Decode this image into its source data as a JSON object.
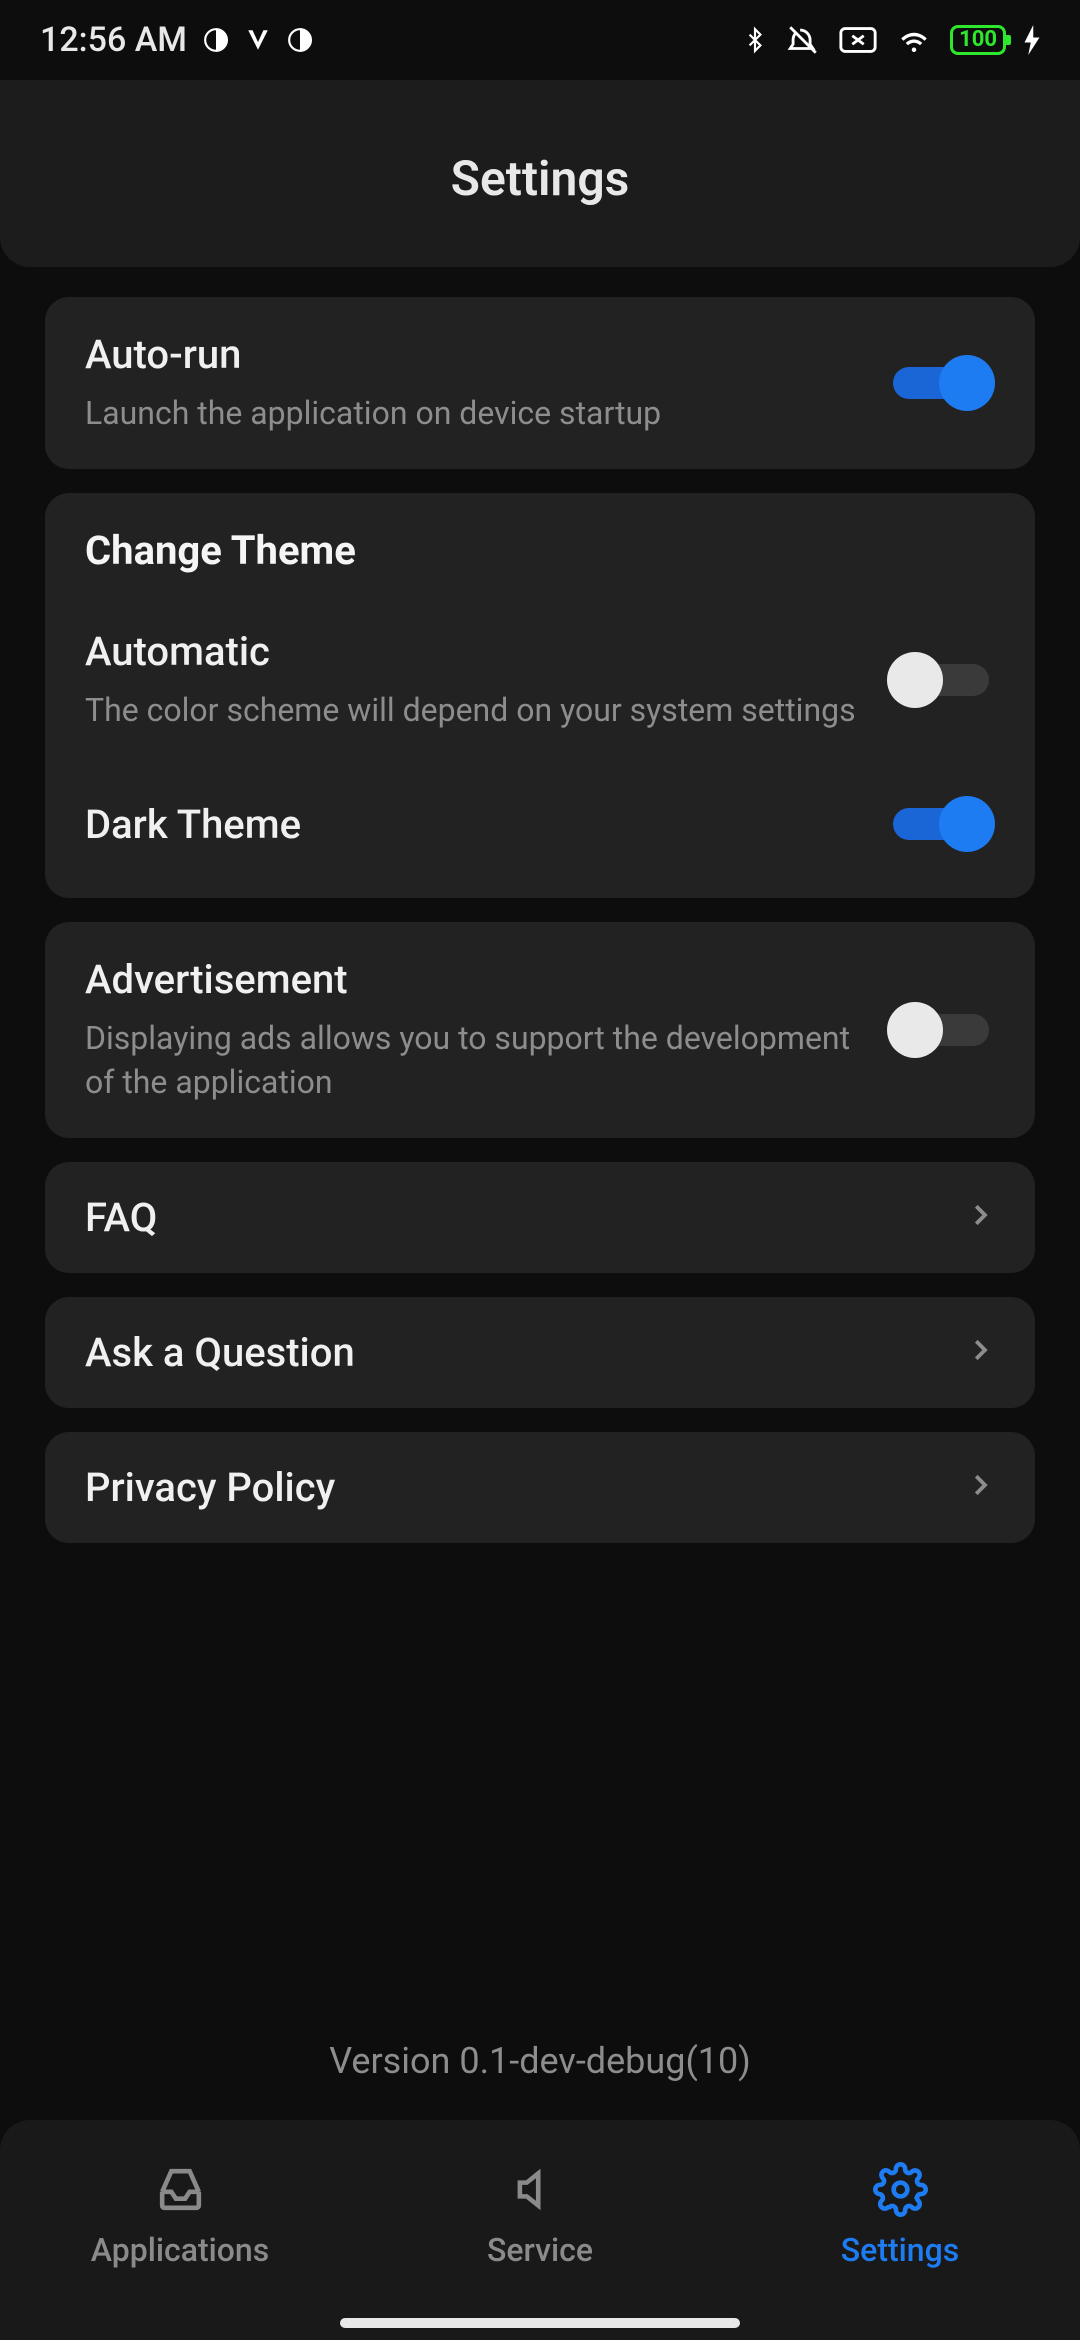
{
  "status": {
    "time": "12:56 AM",
    "battery_text": "100"
  },
  "header": {
    "title": "Settings"
  },
  "settings": {
    "autorun": {
      "title": "Auto-run",
      "subtitle": "Launch the application on device startup",
      "on": true
    },
    "theme_section_title": "Change Theme",
    "automatic": {
      "title": "Automatic",
      "subtitle": "The color scheme will depend on your system settings",
      "on": false
    },
    "dark": {
      "title": "Dark Theme",
      "on": true
    },
    "ads": {
      "title": "Advertisement",
      "subtitle": "Displaying ads allows you to support the development of the application",
      "on": false
    },
    "links": {
      "faq": "FAQ",
      "ask": "Ask a Question",
      "privacy": "Privacy Policy"
    }
  },
  "version": "Version 0.1-dev-debug(10)",
  "nav": {
    "applications": "Applications",
    "service": "Service",
    "settings": "Settings"
  }
}
